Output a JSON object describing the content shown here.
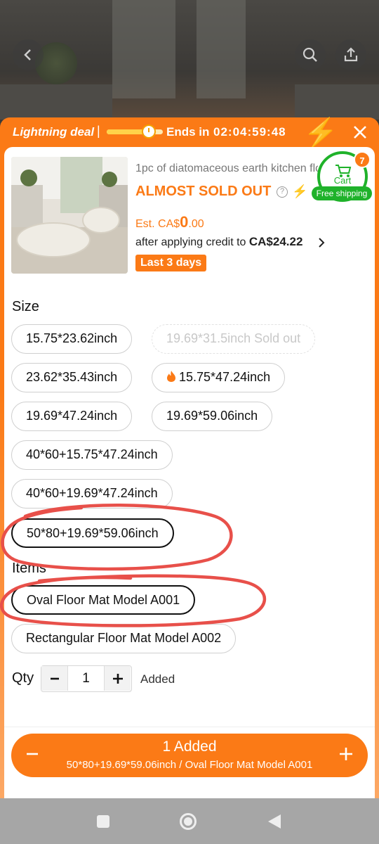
{
  "deal": {
    "label": "Lightning deal",
    "separator": "|",
    "progress": 0.7,
    "ends_label": "Ends in",
    "timer": "02:04:59:48"
  },
  "product": {
    "title": "1pc of diatomaceous earth kitchen floor mat",
    "stock_status": "ALMOST SOLD OUT",
    "est_prefix": "Est. CA$",
    "est_value": "0",
    "est_cents": ".00",
    "credit_text": "after applying credit to ",
    "credit_amount": "CA$24.22",
    "badge": "Last 3 days"
  },
  "cart": {
    "label": "Cart",
    "count": "7",
    "free_shipping": "Free shipping"
  },
  "size": {
    "label": "Size",
    "options": [
      {
        "label": "15.75*23.62inch"
      },
      {
        "label": "19.69*31.5inch",
        "sold_out": "Sold out"
      },
      {
        "label": "23.62*35.43inch"
      },
      {
        "label": "15.75*47.24inch"
      },
      {
        "label": "19.69*47.24inch"
      },
      {
        "label": "19.69*59.06inch"
      },
      {
        "label": "40*60+15.75*47.24inch"
      },
      {
        "label": "40*60+19.69*47.24inch"
      },
      {
        "label": "50*80+19.69*59.06inch"
      }
    ],
    "selected": "50*80+19.69*59.06inch"
  },
  "items": {
    "label": "Items",
    "options": [
      {
        "label": "Oval Floor Mat Model A001"
      },
      {
        "label": "Rectangular Floor Mat Model A002"
      }
    ],
    "selected": "Oval Floor Mat Model A001"
  },
  "qty": {
    "label": "Qty",
    "value": "1",
    "status": "Added"
  },
  "cta": {
    "main": "1 Added",
    "sub": "50*80+19.69*59.06inch / Oval Floor Mat Model A001"
  },
  "colors": {
    "accent": "#fb7a16",
    "cart_green": "#1fb22a",
    "annotation_red": "#e8504a"
  }
}
